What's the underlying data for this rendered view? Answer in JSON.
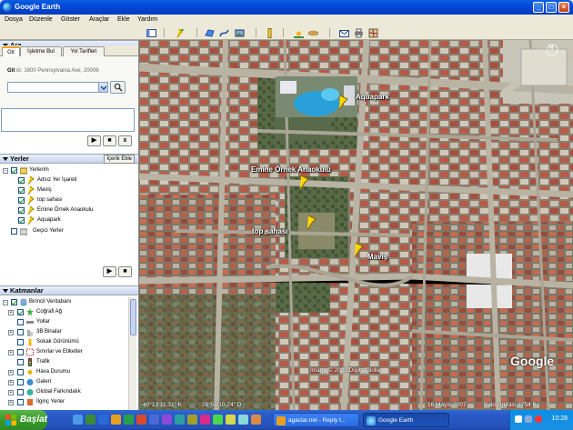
{
  "window": {
    "title": "Google Earth",
    "controls": {
      "minimize": "_",
      "maximize": "□",
      "close": "×"
    },
    "colors": {
      "titlebar": "#0048d8",
      "close": "#c8401a"
    }
  },
  "menu": [
    "Dosya",
    "Düzenle",
    "Göster",
    "Araçlar",
    "Ekle",
    "Yardım"
  ],
  "toolbar_icons": [
    "sidebar-icon",
    "placemark-icon",
    "polygon-icon",
    "path-icon",
    "image-overlay-icon",
    "ruler-icon",
    "sun-icon",
    "planet-icon",
    "email-icon",
    "print-icon",
    "map-view-icon"
  ],
  "search": {
    "title": "Ara",
    "tabs": [
      "Git",
      "İşletme Bul",
      "Yol Tarifleri"
    ],
    "active_tab": "Git",
    "label": "Git",
    "example": "ör. 1600 Pennsylvania Ave, 20006",
    "value": "",
    "controls": {
      "play": "▶",
      "stop": "■",
      "close": "x"
    }
  },
  "places": {
    "title": "Yerler",
    "overview_button": "İçerik Ekle",
    "root": "Yerlerim",
    "items": [
      {
        "label": "Adsız Yer İşareti",
        "checked": true
      },
      {
        "label": "Maviş",
        "checked": true
      },
      {
        "label": "top sahası",
        "checked": true
      },
      {
        "label": "Emine Örnek Anaokulu",
        "checked": true
      },
      {
        "label": "Aquapark",
        "checked": true
      }
    ],
    "temp": "Geçici Yerler",
    "controls": {
      "play": "▶",
      "stop": "■"
    }
  },
  "layers": {
    "title": "Katmanlar",
    "root": "Birincil Veritabanı",
    "items": [
      {
        "label": "Coğrafi Ağ",
        "checked": true
      },
      {
        "label": "Yollar",
        "checked": false
      },
      {
        "label": "3B Binalar",
        "checked": false
      },
      {
        "label": "Sokak Görünümü",
        "checked": false
      },
      {
        "label": "Sınırlar ve Etiketler",
        "checked": false
      },
      {
        "label": "Trafik",
        "checked": false
      },
      {
        "label": "Hava Durumu",
        "checked": false
      },
      {
        "label": "Galeri",
        "checked": false
      },
      {
        "label": "Global Farkındalık",
        "checked": false
      },
      {
        "label": "İlginç Yerler",
        "checked": false
      }
    ]
  },
  "map": {
    "labels": {
      "aquapark": "Aquapark",
      "kindergarten": "Emine Örnek Anaokulu",
      "field": "top sahası",
      "mavis": "Maviş"
    },
    "copyright": "Image © 2009 DigitalGlobe",
    "logo": "Google",
    "coords_lat": "40°13'31.31\" K",
    "coords_lon": "28°58'10.74\" D",
    "date": "16 Mayıs 2007",
    "eye_alt": "Bakış irtifası   2754 ft",
    "compass": "N"
  },
  "taskbar": {
    "start": "Başlat",
    "tasks": [
      {
        "label": "agaclar.net - Reply t...",
        "active": false
      },
      {
        "label": "Google Earth",
        "active": true
      }
    ],
    "clock": "10:28"
  }
}
